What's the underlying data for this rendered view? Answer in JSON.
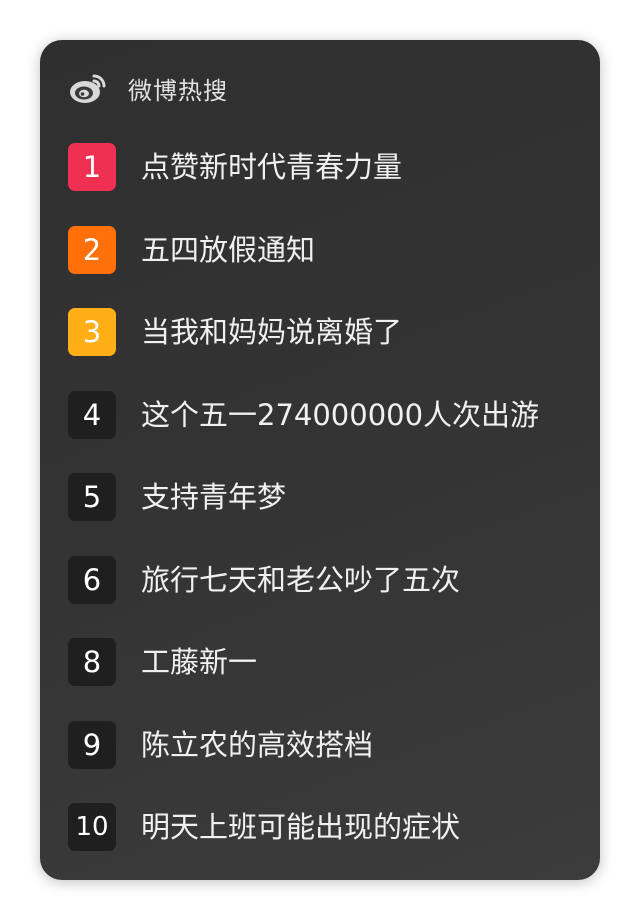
{
  "widget": {
    "title": "微博热搜",
    "logo_icon": "weibo-logo-icon"
  },
  "colors": {
    "rank1": "#f03052",
    "rank2": "#ff6f0a",
    "rank3": "#ffae16",
    "rank_default": "#1f1f1f",
    "background": "#333333"
  },
  "items": [
    {
      "rank": "1",
      "text": "点赞新时代青春力量"
    },
    {
      "rank": "2",
      "text": "五四放假通知"
    },
    {
      "rank": "3",
      "text": "当我和妈妈说离婚了"
    },
    {
      "rank": "4",
      "text": "这个五一274000000人次出游"
    },
    {
      "rank": "5",
      "text": "支持青年梦"
    },
    {
      "rank": "6",
      "text": "旅行七天和老公吵了五次"
    },
    {
      "rank": "8",
      "text": "工藤新一"
    },
    {
      "rank": "9",
      "text": "陈立农的高效搭档"
    },
    {
      "rank": "10",
      "text": "明天上班可能出现的症状"
    }
  ]
}
